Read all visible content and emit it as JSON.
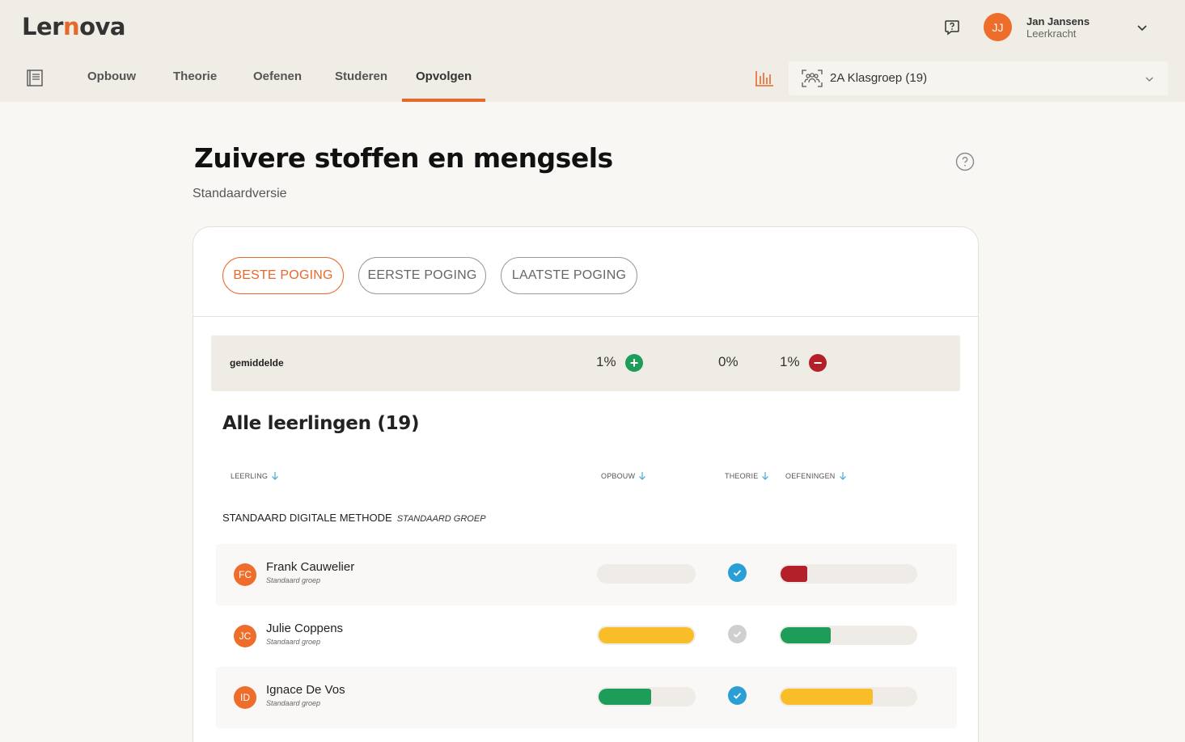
{
  "app": {
    "logo_prefix": "Ler",
    "logo_n": "n",
    "logo_suffix": "ova"
  },
  "user": {
    "initials": "JJ",
    "name": "Jan Jansens",
    "role": "Leerkracht"
  },
  "nav": {
    "tabs": [
      {
        "label": "Opbouw"
      },
      {
        "label": "Theorie"
      },
      {
        "label": "Oefenen"
      },
      {
        "label": "Studeren"
      },
      {
        "label": "Opvolgen",
        "active": true
      }
    ]
  },
  "class_select": {
    "label": "2A Klasgroep (19)"
  },
  "page": {
    "title": "Zuivere stoffen en mengsels",
    "subtitle": "Standaardversie"
  },
  "attempts": [
    {
      "label": "BESTE POGING",
      "active": true
    },
    {
      "label": "EERSTE POGING"
    },
    {
      "label": "LAATSTE POGING"
    }
  ],
  "average": {
    "label": "gemiddelde",
    "opbouw": "1%",
    "opbouw_icon": "plus-icon",
    "theorie": "0%",
    "oefeningen": "1%",
    "oefeningen_icon": "minus-icon"
  },
  "students_section": {
    "title": "Alle leerlingen (19)",
    "columns": {
      "student": "LEERLING",
      "opbouw": "OPBOUW",
      "theorie": "THEORIE",
      "oefeningen": "OEFENINGEN"
    },
    "group": {
      "name": "STANDAARD DIGITALE METHODE",
      "tag": "STANDAARD GROEP"
    },
    "students": [
      {
        "initials": "FC",
        "name": "Frank Cauwelier",
        "group": "Standaard groep",
        "opbouw": 0,
        "opbouw_color": "#f9bd2a",
        "theorie_done": true,
        "oefeningen": 0.2,
        "oefeningen_color": "#b3202a"
      },
      {
        "initials": "JC",
        "name": "Julie Coppens",
        "group": "Standaard groep",
        "opbouw": 1.0,
        "opbouw_color": "#f9bd2a",
        "theorie_done": false,
        "oefeningen": 0.37,
        "oefeningen_color": "#1e9c59"
      },
      {
        "initials": "ID",
        "name": "Ignace De Vos",
        "group": "Standaard groep",
        "opbouw": 0.55,
        "opbouw_color": "#1e9c59",
        "theorie_done": true,
        "oefeningen": 0.68,
        "oefeningen_color": "#f9bd2a"
      }
    ]
  },
  "colors": {
    "accent": "#e8672a",
    "success": "#1e9c59",
    "danger": "#b3202a",
    "warning": "#f9bd2a",
    "check_done": "#2a9fd6",
    "check_pending": "#cfcfcf"
  }
}
